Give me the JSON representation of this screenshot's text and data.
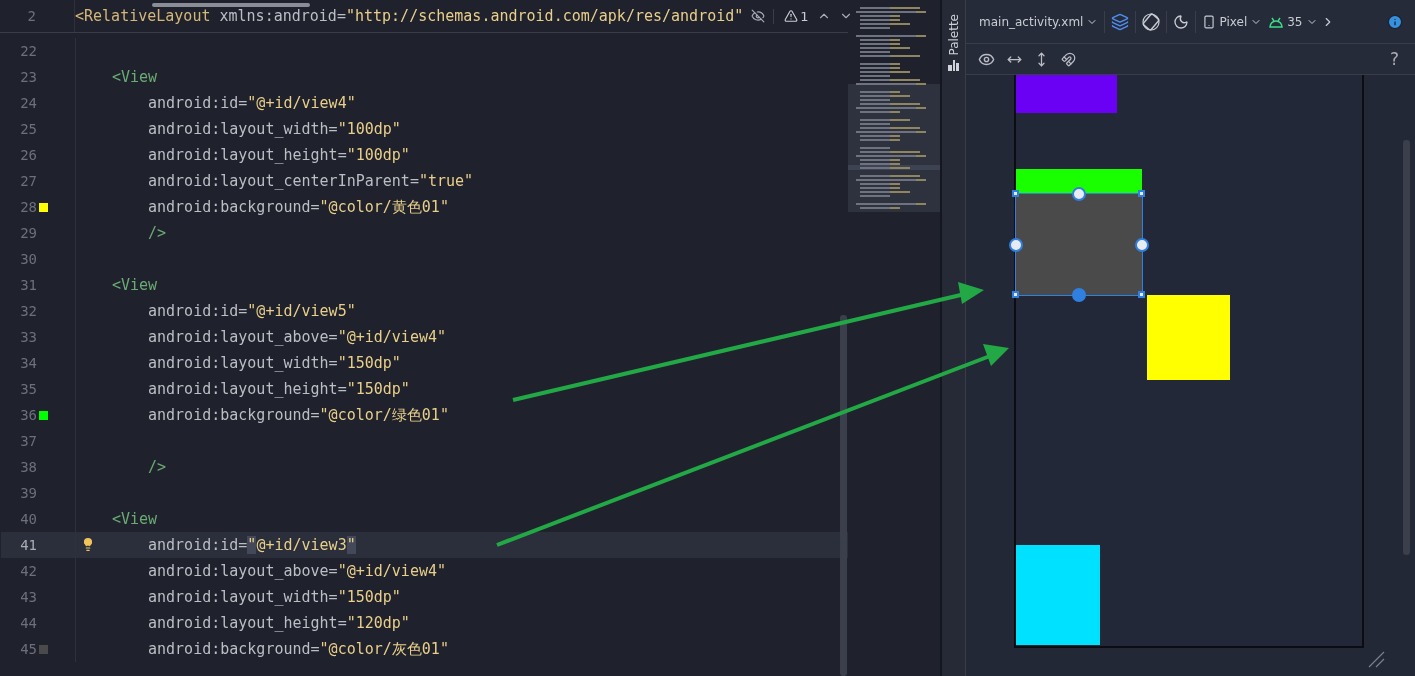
{
  "editor": {
    "sticky_line": {
      "number": "2",
      "tokens": [
        {
          "kind": "element",
          "text": "<RelativeLayout"
        },
        {
          "kind": "attr",
          "text": " xmlns:android="
        },
        {
          "kind": "string",
          "text": "\"http://schemas.android.com/apk/res/android\""
        }
      ],
      "warning_count": "1"
    },
    "lines": [
      {
        "number": "22",
        "current": false
      },
      {
        "number": "23",
        "current": false,
        "tokens": [
          {
            "kind": "tag",
            "text": "<View"
          }
        ]
      },
      {
        "number": "24",
        "current": false,
        "tokens": [
          {
            "kind": "attr",
            "text": "android:id="
          },
          {
            "kind": "string",
            "text": "\"@+id/view4\""
          }
        ]
      },
      {
        "number": "25",
        "current": false,
        "tokens": [
          {
            "kind": "attr",
            "text": "android:layout_width="
          },
          {
            "kind": "string",
            "text": "\"100dp\""
          }
        ]
      },
      {
        "number": "26",
        "current": false,
        "tokens": [
          {
            "kind": "attr",
            "text": "android:layout_height="
          },
          {
            "kind": "string",
            "text": "\"100dp\""
          }
        ]
      },
      {
        "number": "27",
        "current": false,
        "tokens": [
          {
            "kind": "attr",
            "text": "android:layout_centerInParent="
          },
          {
            "kind": "string",
            "text": "\"true\""
          }
        ]
      },
      {
        "number": "28",
        "current": false,
        "swatch": {
          "color": "#ffff00"
        },
        "tokens": [
          {
            "kind": "attr",
            "text": "android:background="
          },
          {
            "kind": "string",
            "text": "\"@color/黄色01\""
          }
        ]
      },
      {
        "number": "29",
        "current": false,
        "tokens": [
          {
            "kind": "close",
            "text": "/>"
          }
        ]
      },
      {
        "number": "30",
        "current": false
      },
      {
        "number": "31",
        "current": false,
        "tokens": [
          {
            "kind": "tag",
            "text": "<View"
          }
        ]
      },
      {
        "number": "32",
        "current": false,
        "tokens": [
          {
            "kind": "attr",
            "text": "android:id="
          },
          {
            "kind": "string",
            "text": "\"@+id/view5\""
          }
        ]
      },
      {
        "number": "33",
        "current": false,
        "tokens": [
          {
            "kind": "attr",
            "text": "android:layout_above="
          },
          {
            "kind": "string",
            "text": "\"@+id/view4\""
          }
        ]
      },
      {
        "number": "34",
        "current": false,
        "tokens": [
          {
            "kind": "attr",
            "text": "android:layout_width="
          },
          {
            "kind": "string",
            "text": "\"150dp\""
          }
        ]
      },
      {
        "number": "35",
        "current": false,
        "tokens": [
          {
            "kind": "attr",
            "text": "android:layout_height="
          },
          {
            "kind": "string",
            "text": "\"150dp\""
          }
        ]
      },
      {
        "number": "36",
        "current": false,
        "swatch": {
          "color": "#00ff00"
        },
        "tokens": [
          {
            "kind": "attr",
            "text": "android:background="
          },
          {
            "kind": "string",
            "text": "\"@color/绿色01\""
          }
        ]
      },
      {
        "number": "37",
        "current": false
      },
      {
        "number": "38",
        "current": false,
        "tokens": [
          {
            "kind": "close",
            "text": "/>"
          }
        ]
      },
      {
        "number": "39",
        "current": false
      },
      {
        "number": "40",
        "current": false,
        "tokens": [
          {
            "kind": "tag",
            "text": "<View"
          }
        ]
      },
      {
        "number": "41",
        "current": true,
        "intention_bulb": true,
        "tokens": [
          {
            "kind": "attr",
            "text": "android:id="
          },
          {
            "kind": "match",
            "text": "\""
          },
          {
            "kind": "string",
            "text": "@+id/view3"
          },
          {
            "kind": "match",
            "text": "\""
          }
        ]
      },
      {
        "number": "42",
        "current": false,
        "tokens": [
          {
            "kind": "attr",
            "text": "android:layout_above="
          },
          {
            "kind": "string",
            "text": "\"@+id/view4\""
          }
        ]
      },
      {
        "number": "43",
        "current": false,
        "tokens": [
          {
            "kind": "attr",
            "text": "android:layout_width="
          },
          {
            "kind": "string",
            "text": "\"150dp\""
          }
        ]
      },
      {
        "number": "44",
        "current": false,
        "tokens": [
          {
            "kind": "attr",
            "text": "android:layout_height="
          },
          {
            "kind": "string",
            "text": "\"120dp\""
          }
        ]
      },
      {
        "number": "45",
        "current": false,
        "swatch": {
          "color": "#4a4a4a"
        },
        "tokens": [
          {
            "kind": "attr",
            "text": "android:background="
          },
          {
            "kind": "string",
            "text": "\"@color/灰色01\""
          }
        ]
      }
    ]
  },
  "palette_tab": {
    "label": "Palette"
  },
  "design_toolbar": {
    "file": "main_activity.xml",
    "device": "Pixel",
    "api_level": "35",
    "help": "?"
  },
  "canvas_views": [
    {
      "color": "#6a00f4",
      "selected": false
    },
    {
      "color": "#1aff00",
      "selected": false
    },
    {
      "color": "#4a4a4a",
      "selected": true
    },
    {
      "color": "#ffff00",
      "selected": false
    },
    {
      "color": "#00e0ff",
      "selected": false
    }
  ]
}
